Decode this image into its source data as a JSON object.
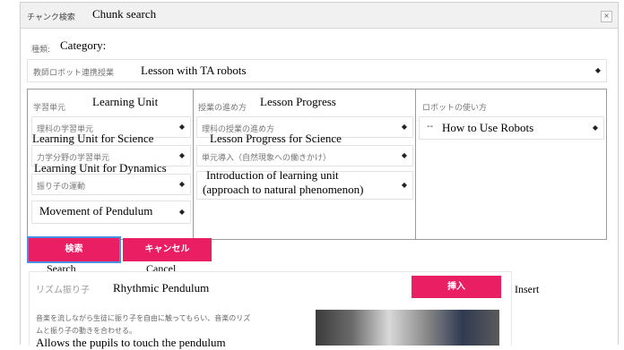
{
  "dialog": {
    "title_jp": "チャンク検索",
    "title_en": "Chunk search",
    "close_glyph": "×"
  },
  "category": {
    "label_jp": "種類:",
    "label_en": "Category:",
    "selected_jp": "教師ロボット連携授業",
    "selected_en": "Lesson with TA robots"
  },
  "columns": {
    "learning_unit": {
      "header_jp": "学習単元",
      "header_en": "Learning Unit",
      "select1_jp": "理科の学習単元",
      "select1_en": "Learning Unit for Science",
      "select2_jp": "力学分野の学習単元",
      "select2_en": "Learning Unit for Dynamics",
      "select3_jp": "振り子の運動",
      "select3_en": "Movement of Pendulum"
    },
    "lesson_progress": {
      "header_jp": "授業の進め方",
      "header_en": "Lesson Progress",
      "select1_jp": "理科の授業の進め方",
      "select1_en": "Lesson Progress for Science",
      "select2_jp": "単元導入（自然現象への働きかけ）",
      "select2_en_line1": "Introduction of learning unit",
      "select2_en_line2": "(approach to natural  phenomenon)"
    },
    "robot_usage": {
      "header_jp": "ロボットの使い方",
      "select1_value": "--",
      "select1_en": "How to Use Robots"
    }
  },
  "buttons": {
    "search_jp": "検索",
    "search_en": "Search",
    "cancel_jp": "キャンセル",
    "cancel_en": "Cancel",
    "insert_jp": "挿入",
    "insert_en": "Insert"
  },
  "result": {
    "title_jp": "リズム振り子",
    "title_en": "Rhythmic Pendulum",
    "desc_jp_line1": "音楽を流しながら生徒に振り子を自由に触ってもらい、音楽のリズ",
    "desc_jp_line2": "ムと振り子の動きを合わせる。",
    "desc_en": "Allows the pupils to touch the pendulum"
  },
  "colors": {
    "accent": "#e91e63",
    "focus": "#4a90e2"
  }
}
